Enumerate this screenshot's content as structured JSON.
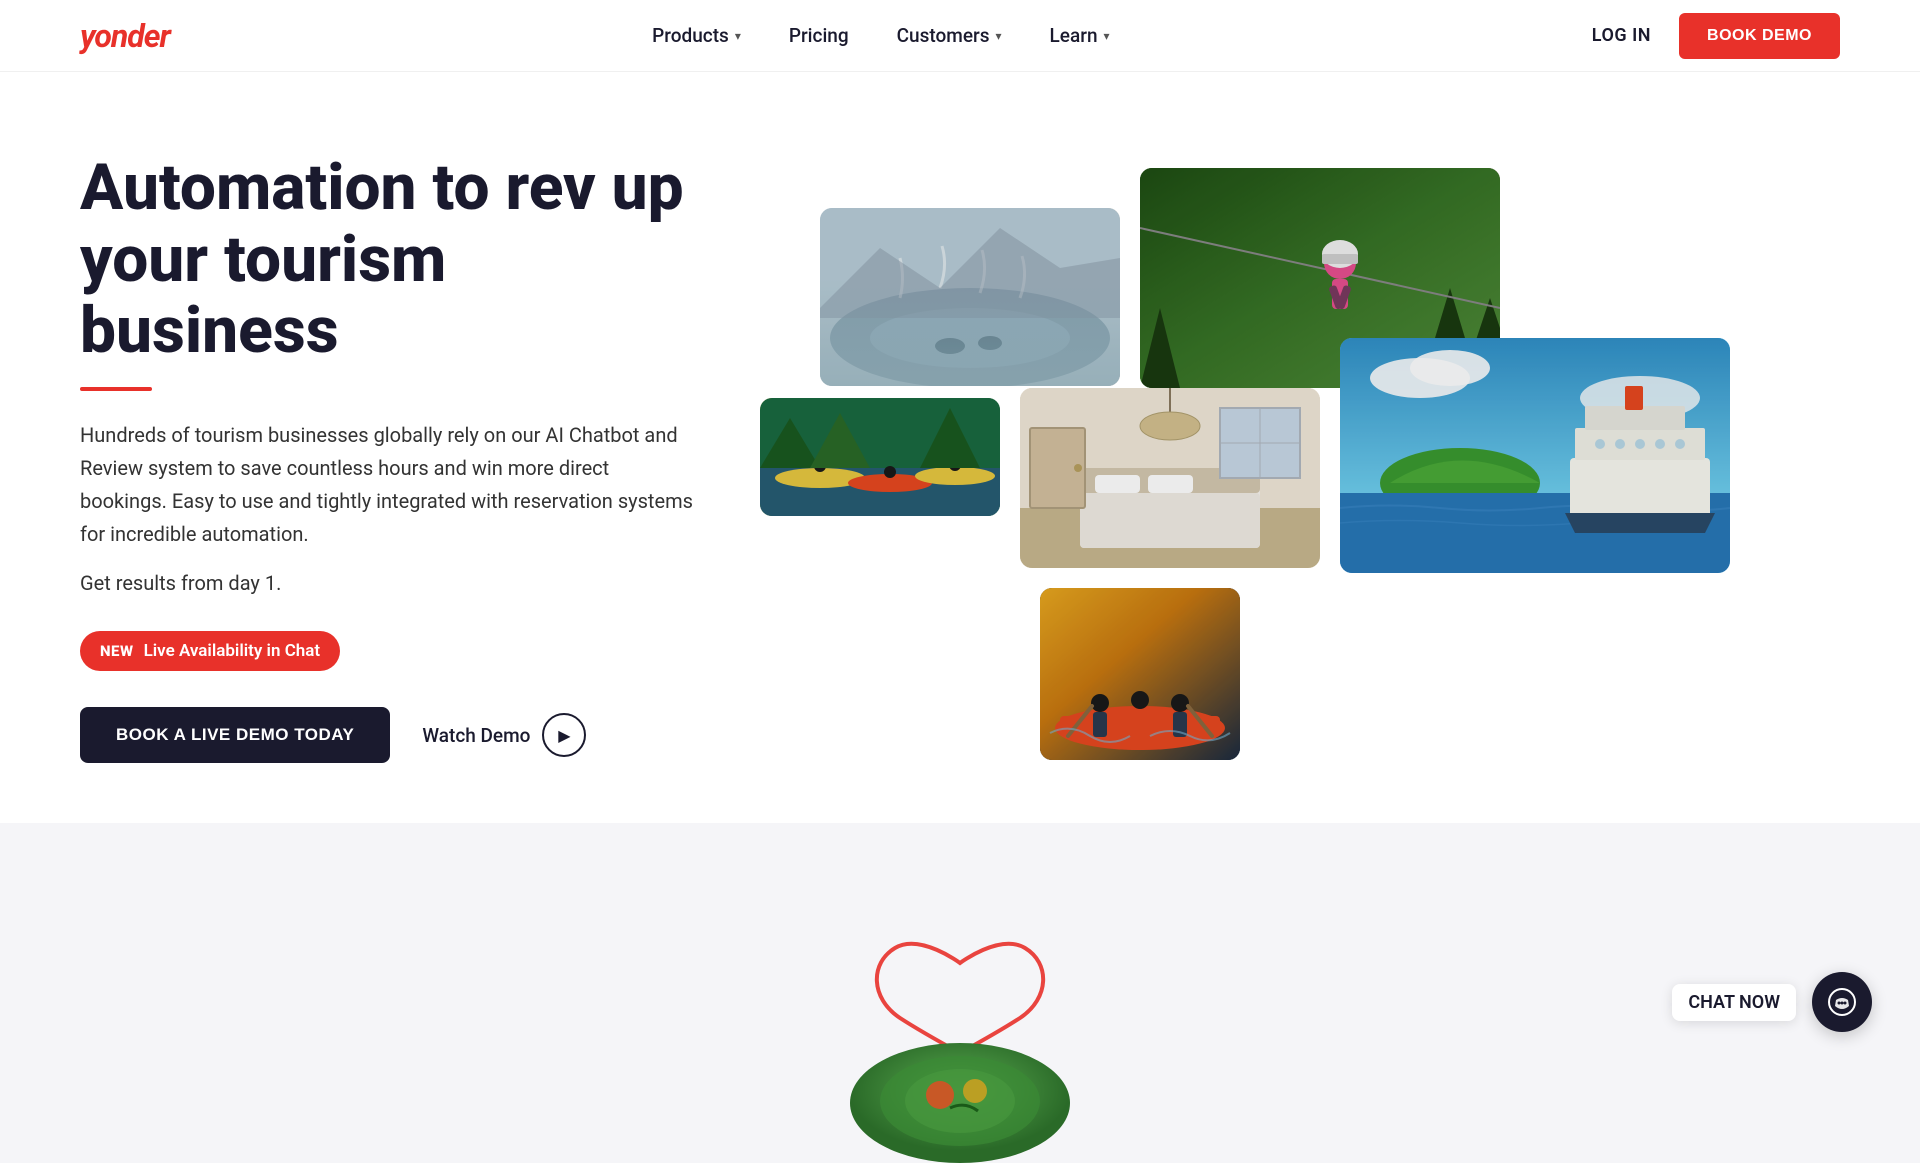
{
  "brand": {
    "logo": "yonder",
    "accent_color": "#e8312a",
    "dark_color": "#1a1a2e"
  },
  "nav": {
    "links": [
      {
        "label": "Products",
        "has_dropdown": true
      },
      {
        "label": "Pricing",
        "has_dropdown": false
      },
      {
        "label": "Customers",
        "has_dropdown": true
      },
      {
        "label": "Learn",
        "has_dropdown": true
      }
    ],
    "login_label": "LOG IN",
    "book_demo_label": "BOOK DEMO"
  },
  "hero": {
    "title": "Automation to rev up your tourism business",
    "description": "Hundreds of tourism businesses globally rely on our AI Chatbot and Review system to save countless hours and win more direct bookings. Easy to use and tightly integrated with reservation systems for incredible automation.",
    "sub_text": "Get results from day 1.",
    "badge_new": "NEW",
    "badge_text": "Live Availability in Chat",
    "cta_primary": "BOOK A LIVE DEMO TODAY",
    "cta_secondary": "Watch Demo"
  },
  "chat_widget": {
    "label": "CHAT NOW",
    "icon": "chat-icon"
  },
  "images": [
    {
      "id": "hot-springs",
      "alt": "Hot springs tourism"
    },
    {
      "id": "zipline",
      "alt": "Zipline adventure"
    },
    {
      "id": "kayak",
      "alt": "Kayak tour"
    },
    {
      "id": "bedroom",
      "alt": "Luxury bedroom accommodation"
    },
    {
      "id": "cruise",
      "alt": "Cruise boat on blue water"
    },
    {
      "id": "adventure",
      "alt": "Adventure activity"
    }
  ]
}
